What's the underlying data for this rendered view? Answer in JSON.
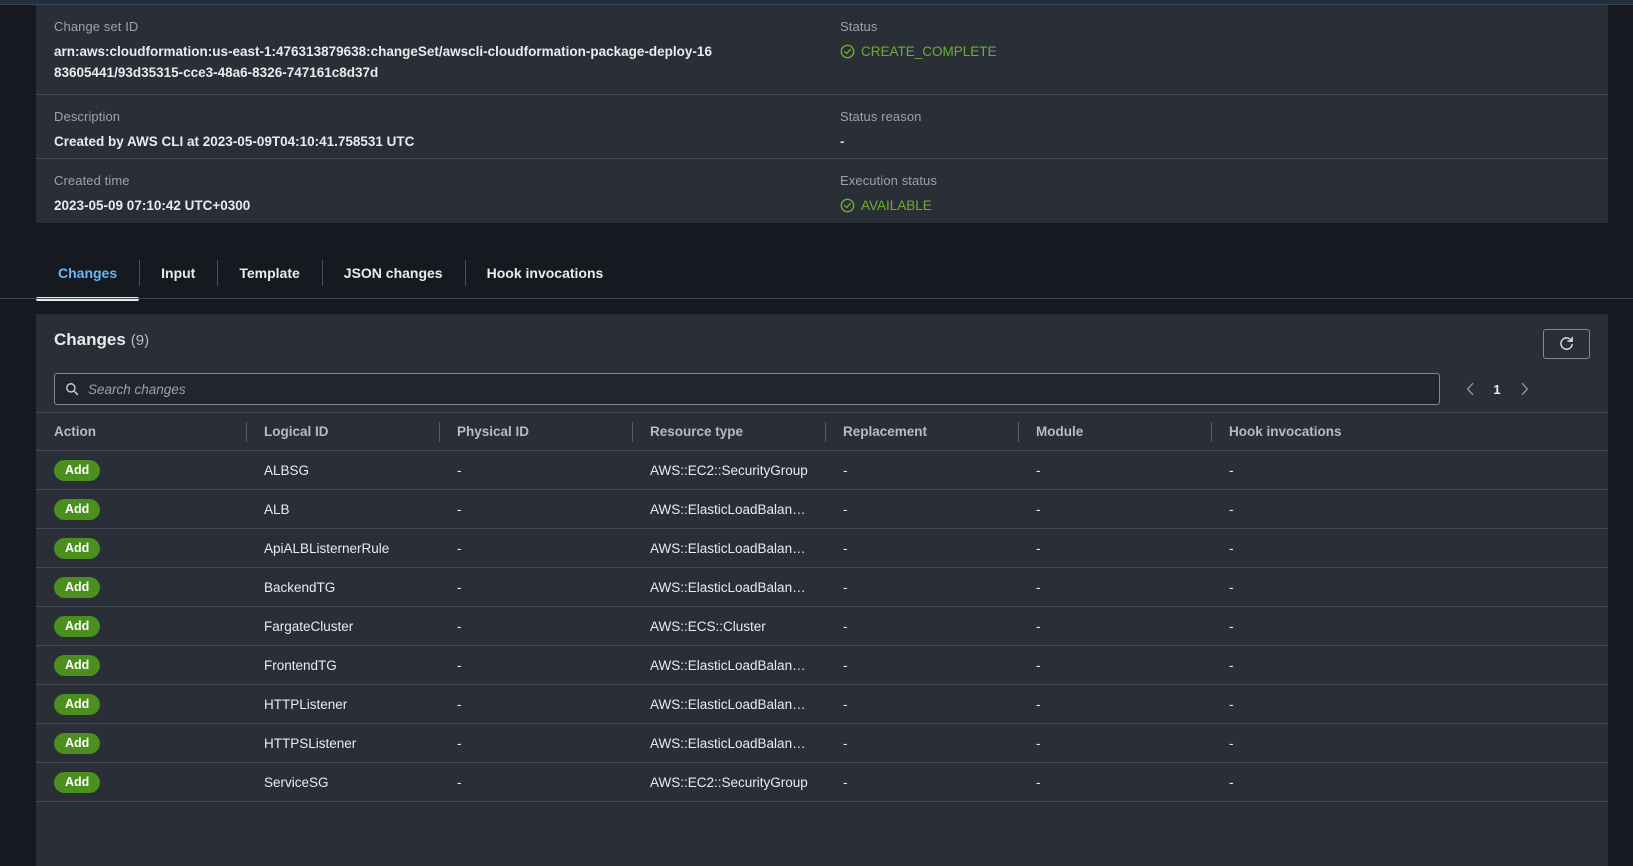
{
  "detail": {
    "rows": [
      {
        "left": {
          "label": "Change set ID",
          "value": "arn:aws:cloudformation:us-east-1:476313879638:changeSet/awscli-cloudformation-package-deploy-1683605441/93d35315-cce3-48a6-8326-747161c8d37d",
          "type": "text"
        },
        "right": {
          "label": "Status",
          "value": "CREATE_COMPLETE",
          "type": "status",
          "icon": "check-circle-icon",
          "color": "#6aaf35"
        }
      },
      {
        "left": {
          "label": "Description",
          "value": "Created by AWS CLI at 2023-05-09T04:10:41.758531 UTC",
          "type": "text"
        },
        "right": {
          "label": "Status reason",
          "value": "-",
          "type": "text"
        }
      },
      {
        "left": {
          "label": "Created time",
          "value": "2023-05-09 07:10:42 UTC+0300",
          "type": "text"
        },
        "right": {
          "label": "Execution status",
          "value": "AVAILABLE",
          "type": "status",
          "icon": "check-circle-icon",
          "color": "#6aaf35"
        }
      }
    ]
  },
  "tabs": {
    "items": [
      {
        "label": "Changes",
        "active": true
      },
      {
        "label": "Input",
        "active": false
      },
      {
        "label": "Template",
        "active": false
      },
      {
        "label": "JSON changes",
        "active": false
      },
      {
        "label": "Hook invocations",
        "active": false
      }
    ]
  },
  "changes": {
    "title": "Changes",
    "count": "(9)",
    "refresh_icon": "refresh-icon",
    "search": {
      "placeholder": "Search changes",
      "value": "",
      "icon": "search-icon"
    },
    "pagination": {
      "prev_icon": "chevron-left-icon",
      "next_icon": "chevron-right-icon",
      "current_page": "1"
    },
    "columns": [
      "Action",
      "Logical ID",
      "Physical ID",
      "Resource type",
      "Replacement",
      "Module",
      "Hook invocations"
    ],
    "rows": [
      {
        "action": "Add",
        "logical_id": "ALBSG",
        "physical_id": "-",
        "resource_type": "AWS::EC2::SecurityGroup",
        "replacement": "-",
        "module": "-",
        "hook_invocations": "-"
      },
      {
        "action": "Add",
        "logical_id": "ALB",
        "physical_id": "-",
        "resource_type": "AWS::ElasticLoadBalan…",
        "replacement": "-",
        "module": "-",
        "hook_invocations": "-"
      },
      {
        "action": "Add",
        "logical_id": "ApiALBListernerRule",
        "physical_id": "-",
        "resource_type": "AWS::ElasticLoadBalan…",
        "replacement": "-",
        "module": "-",
        "hook_invocations": "-"
      },
      {
        "action": "Add",
        "logical_id": "BackendTG",
        "physical_id": "-",
        "resource_type": "AWS::ElasticLoadBalan…",
        "replacement": "-",
        "module": "-",
        "hook_invocations": "-"
      },
      {
        "action": "Add",
        "logical_id": "FargateCluster",
        "physical_id": "-",
        "resource_type": "AWS::ECS::Cluster",
        "replacement": "-",
        "module": "-",
        "hook_invocations": "-"
      },
      {
        "action": "Add",
        "logical_id": "FrontendTG",
        "physical_id": "-",
        "resource_type": "AWS::ElasticLoadBalan…",
        "replacement": "-",
        "module": "-",
        "hook_invocations": "-"
      },
      {
        "action": "Add",
        "logical_id": "HTTPListener",
        "physical_id": "-",
        "resource_type": "AWS::ElasticLoadBalan…",
        "replacement": "-",
        "module": "-",
        "hook_invocations": "-"
      },
      {
        "action": "Add",
        "logical_id": "HTTPSListener",
        "physical_id": "-",
        "resource_type": "AWS::ElasticLoadBalan…",
        "replacement": "-",
        "module": "-",
        "hook_invocations": "-"
      },
      {
        "action": "Add",
        "logical_id": "ServiceSG",
        "physical_id": "-",
        "resource_type": "AWS::EC2::SecurityGroup",
        "replacement": "-",
        "module": "-",
        "hook_invocations": "-"
      }
    ]
  },
  "colors": {
    "panel_bg": "#2a2e36",
    "page_bg": "#16191f",
    "accent_link": "#6ab7f5",
    "status_green": "#6aaf35",
    "badge_green": "#4b8f1e",
    "divider": "#414750"
  }
}
